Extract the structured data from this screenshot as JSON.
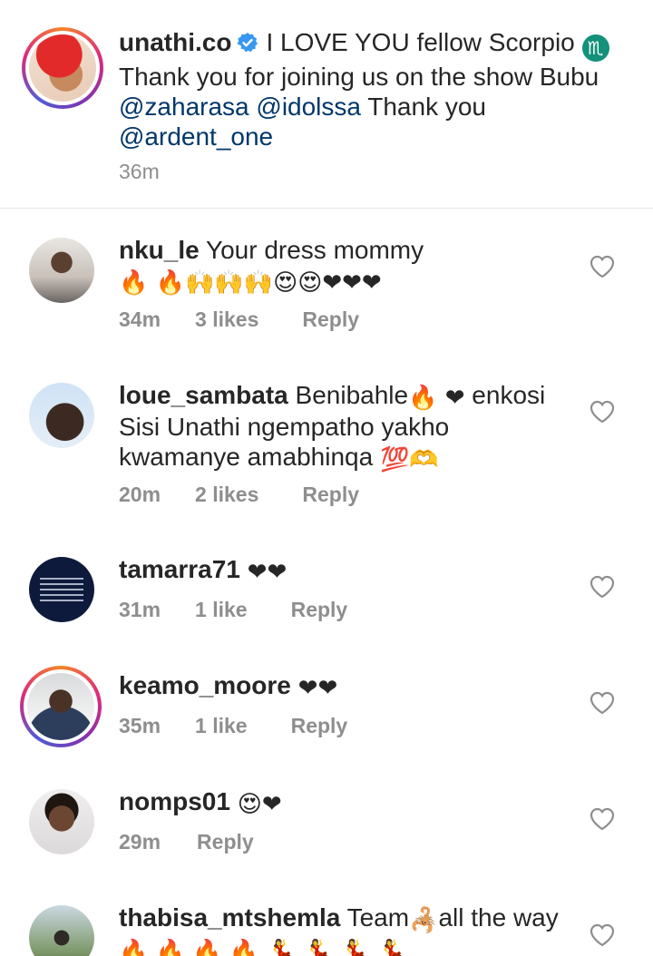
{
  "caption": {
    "username": "unathi.co",
    "text_a": "I LOVE YOU fellow Scorpio",
    "scorpio_icon": "♏",
    "text_b": " Thank you for joining us on the show Bubu ",
    "mention_1": "@zaharasa",
    "mention_2": "@idolssa",
    "text_c": " Thank you ",
    "mention_3": "@ardent_one",
    "time": "36m"
  },
  "comments": [
    {
      "username": "nku_le",
      "text": "Your dress mommy",
      "emojis": " 🔥 🔥🙌🙌🙌😍😍❤❤❤",
      "time": "34m",
      "likes": "3 likes",
      "reply": "Reply"
    },
    {
      "username": "loue_sambata",
      "text": "Benibahle",
      "emojis": "🔥 ❤",
      "text_2": " enkosi Sisi Unathi ngempatho yakho kwamanye amabhinqa ",
      "emojis_2": "💯",
      "trailing": "🫶",
      "time": "20m",
      "likes": "2 likes",
      "reply": "Reply"
    },
    {
      "username": "tamarra71",
      "text": "",
      "emojis": "❤❤",
      "time": "31m",
      "likes": "1 like",
      "reply": "Reply"
    },
    {
      "username": "keamo_moore",
      "text": "",
      "emojis": "❤❤",
      "time": "35m",
      "likes": "1 like",
      "reply": "Reply"
    },
    {
      "username": "nomps01",
      "text": "",
      "emojis": "😍❤",
      "time": "29m",
      "likes": "",
      "reply": "Reply"
    },
    {
      "username": "thabisa_mtshemla",
      "text": "Team",
      "emojis": " 🦂 ",
      "text_2": "all the way",
      "emojis_2": "🔥 🔥 🔥 🔥 💃 💃 💃 💃",
      "time": "",
      "likes": "",
      "reply": ""
    }
  ],
  "colors": {
    "text": "#262626",
    "muted": "#8e8e8e",
    "mention": "#00376b",
    "verified": "#3897f0",
    "divider": "#e6e6e6"
  }
}
